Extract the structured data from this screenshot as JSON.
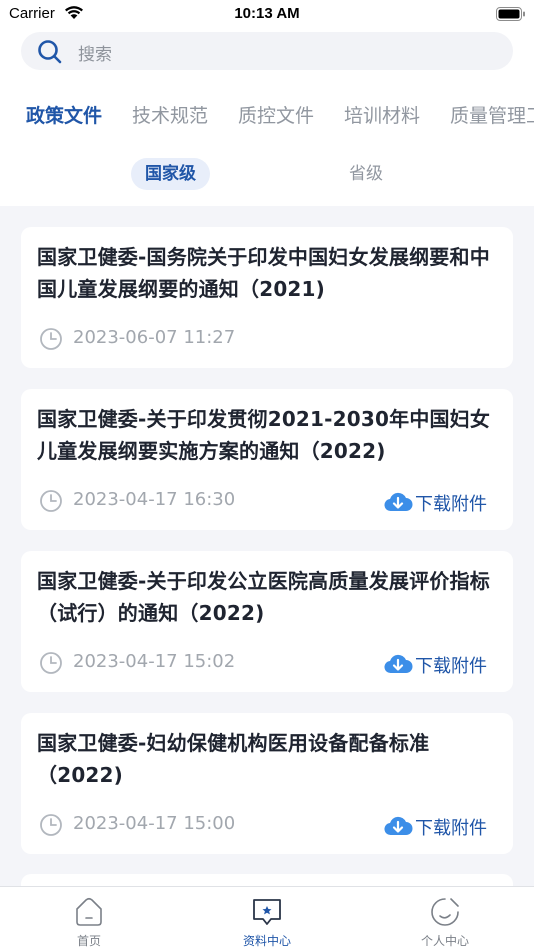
{
  "status_bar": {
    "carrier": "Carrier",
    "time": "10:13 AM"
  },
  "search": {
    "placeholder": "搜索"
  },
  "tabs": [
    {
      "label": "政策文件",
      "active": true
    },
    {
      "label": "技术规范",
      "active": false
    },
    {
      "label": "质控文件",
      "active": false
    },
    {
      "label": "培训材料",
      "active": false
    },
    {
      "label": "质量管理工",
      "active": false
    }
  ],
  "subtabs": [
    {
      "label": "国家级",
      "active": true
    },
    {
      "label": "省级",
      "active": false
    }
  ],
  "documents": [
    {
      "title": "国家卫健委-国务院关于印发中国妇女发展纲要和中国儿童发展纲要的通知（2021)",
      "time": "2023-06-07 11:27",
      "download_label": ""
    },
    {
      "title": "国家卫健委-关于印发贯彻2021-2030年中国妇女儿童发展纲要实施方案的通知（2022)",
      "time": "2023-04-17 16:30",
      "download_label": "下载附件"
    },
    {
      "title": "国家卫健委-关于印发公立医院高质量发展评价指标（试行）的通知（2022)",
      "time": "2023-04-17 15:02",
      "download_label": "下载附件"
    },
    {
      "title": "国家卫健委-妇幼保健机构医用设备配备标准（2022)",
      "time": "2023-04-17 15:00",
      "download_label": "下载附件"
    }
  ],
  "bottom_nav": [
    {
      "label": "首页",
      "icon": "home-icon",
      "active": false
    },
    {
      "label": "资料中心",
      "icon": "document-center-icon",
      "active": true
    },
    {
      "label": "个人中心",
      "icon": "profile-icon",
      "active": false
    }
  ],
  "colors": {
    "accent": "#2056a8",
    "download_icon": "#3c8ee8",
    "background": "#f4f5f9"
  }
}
